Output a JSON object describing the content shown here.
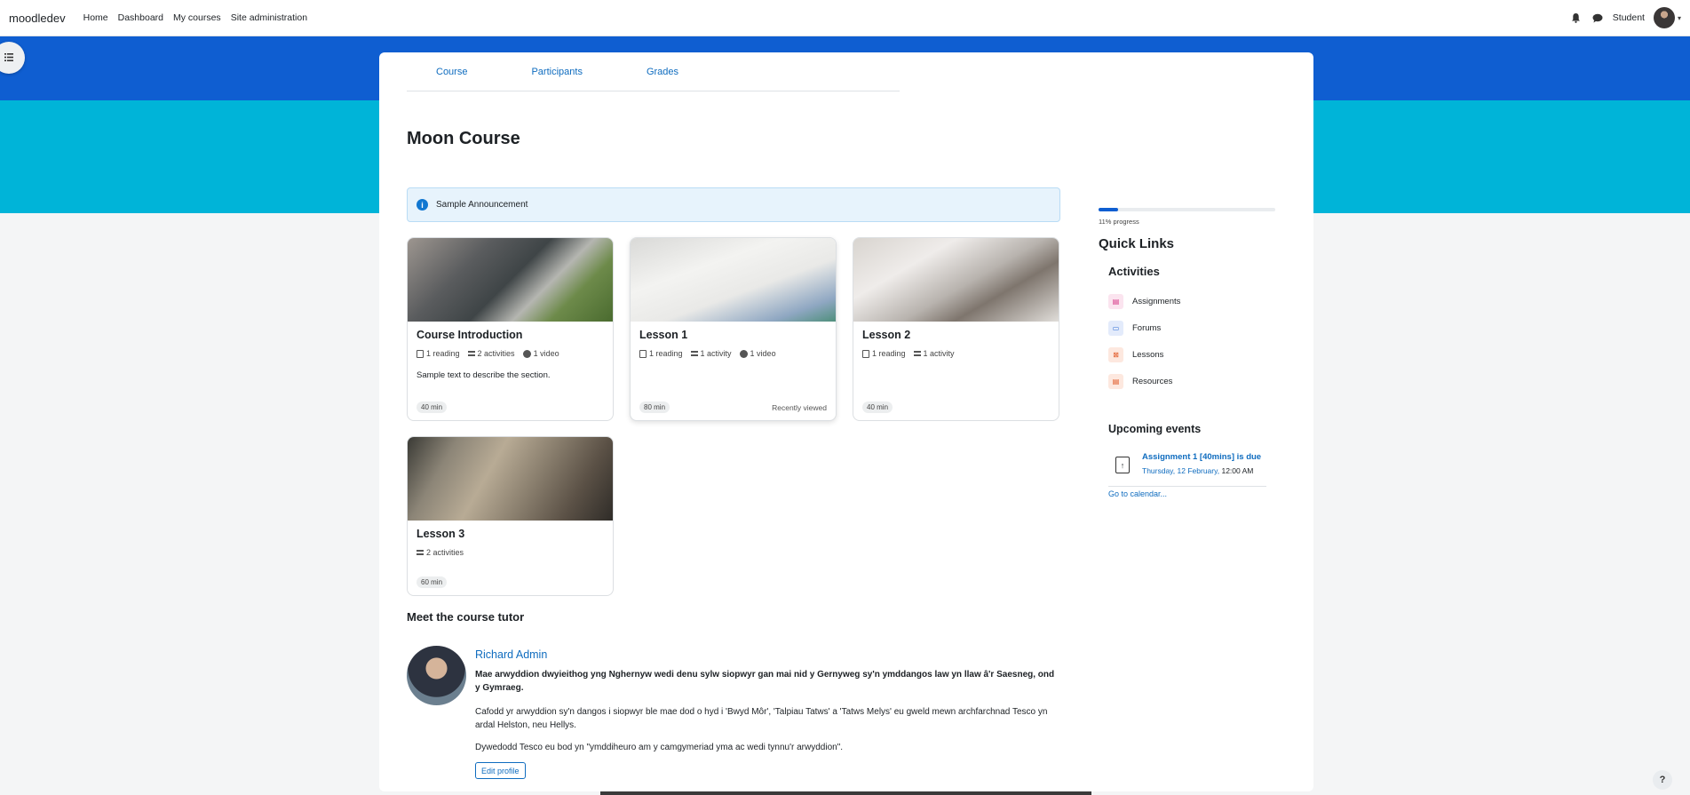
{
  "navbar": {
    "brand": "moodledev",
    "links": [
      "Home",
      "Dashboard",
      "My courses",
      "Site administration"
    ],
    "user_name": "Student"
  },
  "course": {
    "tabs": [
      "Course",
      "Participants",
      "Grades"
    ],
    "title": "Moon Course",
    "announcement": "Sample Announcement"
  },
  "sections": [
    {
      "title": "Course Introduction",
      "meta": [
        "1 reading",
        "2 activities",
        "1 video"
      ],
      "description": "Sample text to describe the section.",
      "duration": "40 min",
      "status": ""
    },
    {
      "title": "Lesson 1",
      "meta": [
        "1 reading",
        "1 activity",
        "1 video"
      ],
      "description": "",
      "duration": "80 min",
      "status": "Recently viewed"
    },
    {
      "title": "Lesson 2",
      "meta": [
        "1 reading",
        "1 activity"
      ],
      "description": "",
      "duration": "40 min",
      "status": ""
    },
    {
      "title": "Lesson 3",
      "meta": [
        "2 activities"
      ],
      "description": "",
      "duration": "60 min",
      "status": ""
    }
  ],
  "tutor": {
    "heading": "Meet the course tutor",
    "name": "Richard Admin",
    "bold_text": "Mae arwyddion dwyieithog yng Nghernyw wedi denu sylw siopwyr gan mai nid y Gernyweg sy'n ymddangos law yn llaw â'r Saesneg, ond y Gymraeg.",
    "paragraph1": "Cafodd yr arwyddion sy'n dangos i siopwyr ble mae dod o hyd i 'Bwyd Môr', 'Talpiau Tatws' a 'Tatws Melys' eu gweld mewn archfarchnad Tesco yn ardal Helston, neu Hellys.",
    "paragraph2": "Dywedodd Tesco eu bod yn \"ymddiheuro am y camgymeriad yma ac wedi tynnu'r arwyddion\".",
    "edit_button": "Edit profile"
  },
  "sidebar": {
    "progress_percent": 11,
    "progress_label": "11% progress",
    "quick_links_title": "Quick Links",
    "activities_title": "Activities",
    "activities": [
      {
        "label": "Assignments",
        "icon": "assignment-icon",
        "color": "#d63384",
        "bg": "#fbe4ef"
      },
      {
        "label": "Forums",
        "icon": "forum-icon",
        "color": "#2f6fd6",
        "bg": "#e3ebfb"
      },
      {
        "label": "Lessons",
        "icon": "lesson-icon",
        "color": "#e0531f",
        "bg": "#fde8df"
      },
      {
        "label": "Resources",
        "icon": "resource-icon",
        "color": "#e0531f",
        "bg": "#fde8df"
      }
    ],
    "upcoming_title": "Upcoming events",
    "event": {
      "title": "Assignment 1 [40mins] is due",
      "date": "Thursday, 12 February,",
      "time": "12:00 AM"
    },
    "calendar_link": "Go to calendar..."
  },
  "help": "?"
}
